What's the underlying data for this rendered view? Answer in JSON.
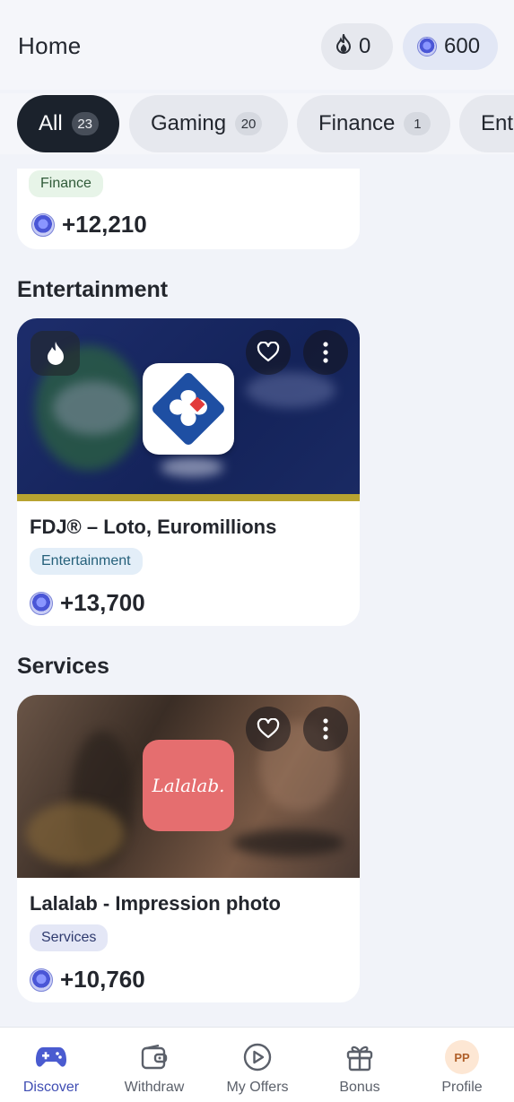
{
  "header": {
    "title": "Home",
    "streak_count": "0",
    "coin_balance": "600"
  },
  "tabs": [
    {
      "label": "All",
      "count": "23"
    },
    {
      "label": "Gaming",
      "count": "20"
    },
    {
      "label": "Finance",
      "count": "1"
    },
    {
      "label": "Ent",
      "count": ""
    }
  ],
  "top_card": {
    "category": "Finance",
    "reward": "+12,210"
  },
  "sections": [
    {
      "title": "Entertainment",
      "offer": {
        "name": "FDJ® – Loto, Euromillions",
        "category": "Entertainment",
        "reward": "+13,700",
        "logo_text": ""
      }
    },
    {
      "title": "Services",
      "offer": {
        "name": "Lalalab - Impression photo",
        "category": "Services",
        "reward": "+10,760",
        "logo_text": "Lalalab."
      }
    }
  ],
  "bottom_nav": [
    {
      "label": "Discover",
      "icon": "gamepad-icon"
    },
    {
      "label": "Withdraw",
      "icon": "wallet-icon"
    },
    {
      "label": "My Offers",
      "icon": "play-circle-icon"
    },
    {
      "label": "Bonus",
      "icon": "gift-icon"
    },
    {
      "label": "Profile",
      "icon": "avatar",
      "initials": "PP"
    }
  ],
  "colors": {
    "accent": "#3f4db3",
    "active_tab": "#1b222c",
    "lalalab_brand": "#e56e6f"
  }
}
